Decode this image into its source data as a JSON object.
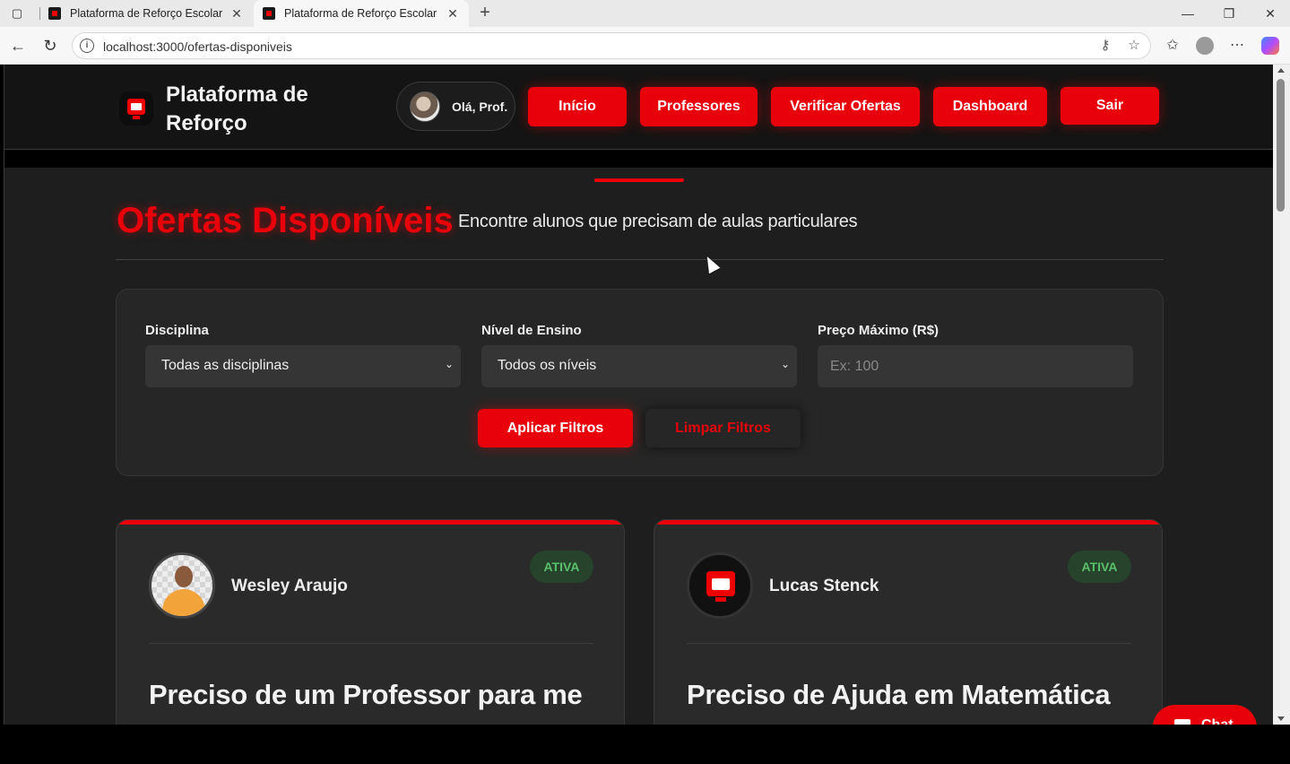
{
  "browser": {
    "tabs": [
      {
        "title": "Plataforma de Reforço Escolar",
        "active": false
      },
      {
        "title": "Plataforma de Reforço Escolar",
        "active": true
      }
    ],
    "new_tab_icon": "plus-icon",
    "url": "localhost:3000/ofertas-disponiveis",
    "icons": [
      "tab-actions-icon",
      "back-icon",
      "reload-icon",
      "site-info-icon",
      "key-icon",
      "star-icon",
      "favorites-icon",
      "profile-icon",
      "more-icon",
      "copilot-icon",
      "minimize-icon",
      "restore-icon",
      "close-icon"
    ]
  },
  "header": {
    "brand": "Plataforma de Reforço",
    "greeting": "Olá, Prof.",
    "nav": {
      "inicio": "Início",
      "professores": "Professores",
      "verificar": "Verificar Ofertas",
      "dashboard": "Dashboard",
      "sair": "Sair"
    }
  },
  "page": {
    "title": "Ofertas Disponíveis",
    "subtitle": "Encontre alunos que precisam de aulas particulares"
  },
  "filters": {
    "disciplina_label": "Disciplina",
    "disciplina_value": "Todas as disciplinas",
    "nivel_label": "Nível de Ensino",
    "nivel_value": "Todos os níveis",
    "preco_label": "Preço Máximo (R$)",
    "preco_placeholder": "Ex: 100",
    "apply_label": "Aplicar Filtros",
    "clear_label": "Limpar Filtros"
  },
  "offers": [
    {
      "name": "Wesley Araujo",
      "status": "ATIVA",
      "title": "Preciso de um Professor para me"
    },
    {
      "name": "Lucas Stenck",
      "status": "ATIVA",
      "title": "Preciso de Ajuda em Matemática"
    }
  ],
  "chat": {
    "label": "Chat"
  },
  "colors": {
    "accent": "#e8000b",
    "background": "#1e1e1e",
    "panel": "#262626",
    "badge_text": "#58c06a"
  }
}
